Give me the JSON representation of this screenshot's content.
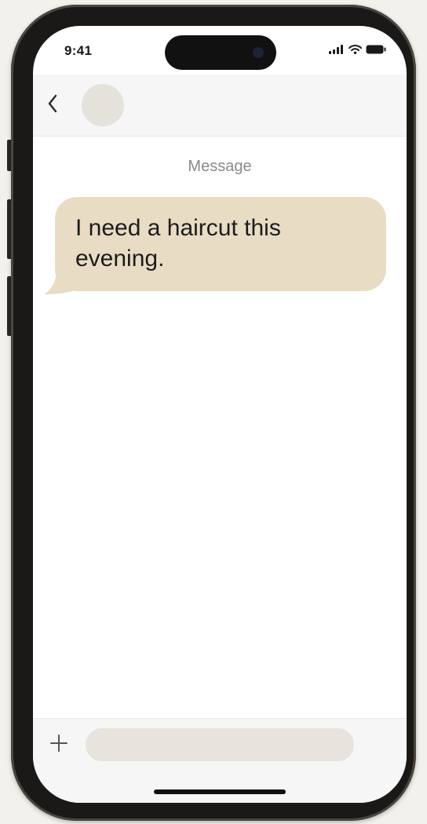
{
  "status_bar": {
    "time": "9:41",
    "icons": [
      "signal-icon",
      "wifi-icon",
      "battery-icon"
    ]
  },
  "header": {
    "back_icon": "chevron-left-icon",
    "avatar": "contact-avatar"
  },
  "thread": {
    "label": "Message",
    "messages": [
      {
        "direction": "incoming",
        "text": "I need a haircut this evening."
      }
    ]
  },
  "composer": {
    "add_icon": "plus-icon",
    "placeholder": "",
    "value": ""
  },
  "colors": {
    "incoming_bubble": "#e9dcc4",
    "avatar": "#e5e2dc",
    "compose_field": "#e7e3dd",
    "frame": "#1b1918"
  }
}
